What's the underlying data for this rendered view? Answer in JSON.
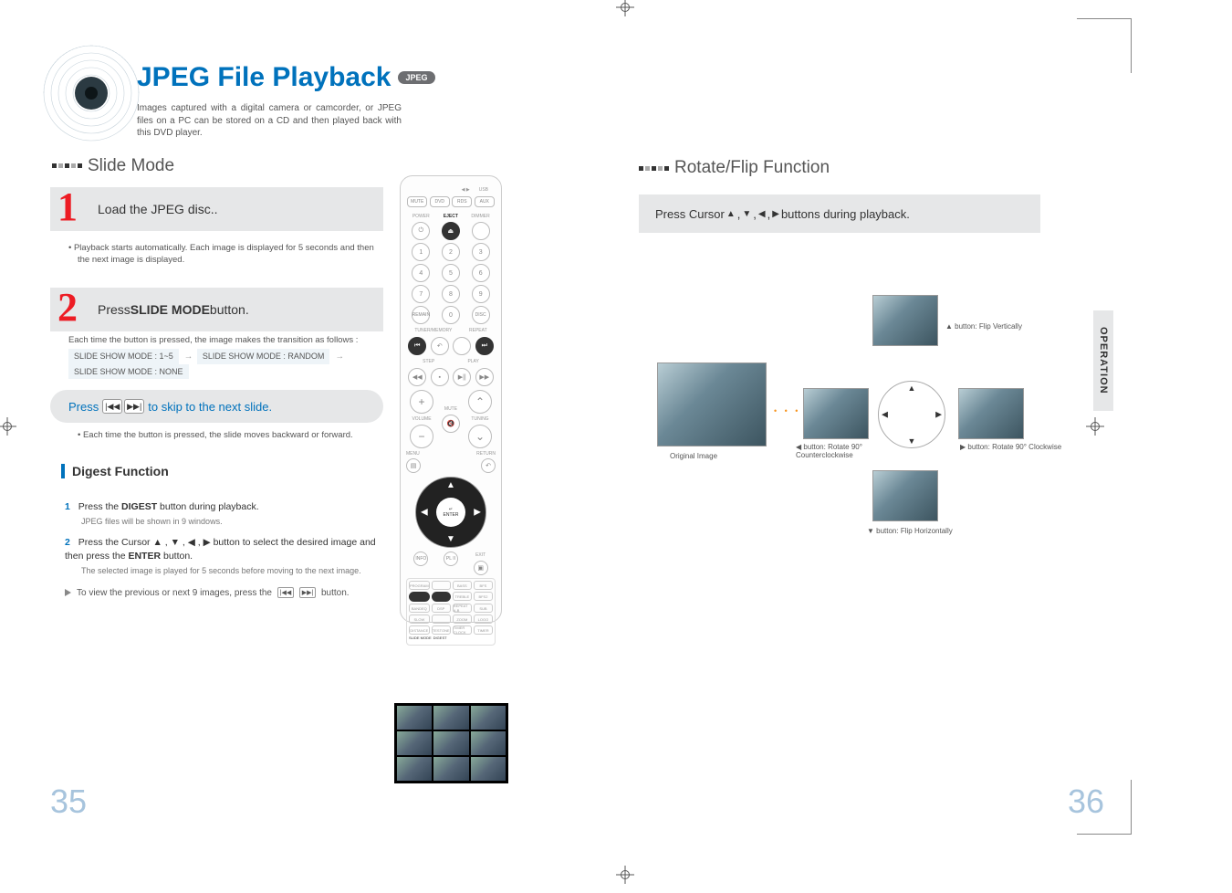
{
  "title": "JPEG File Playback",
  "title_badge": "JPEG",
  "intro": "Images captured with a digital camera or camcorder, or JPEG files on a PC can be stored on a CD and then played back with this DVD player.",
  "side_tab": "OPERATION",
  "page_left": "35",
  "page_right": "36",
  "left": {
    "section": "Slide Mode",
    "step1_num": "1",
    "step1_head": "Load the JPEG disc..",
    "step1_body": "• Playback starts automatically. Each image is displayed for 5 seconds and then the next image is displayed.",
    "step2_num": "2",
    "step2_head_a": "Press ",
    "step2_head_b": "SLIDE MODE",
    "step2_head_c": " button.",
    "transition_intro": "Each time the button is pressed, the image makes the transition as follows :",
    "mode1": "SLIDE SHOW MODE : 1~5",
    "mode2": "SLIDE SHOW MODE : RANDOM",
    "mode3": "SLIDE SHOW MODE : NONE",
    "pill_a": "Press ",
    "pill_b": " to skip to the next slide.",
    "pill_sub": "• Each time the button is pressed, the slide moves backward or forward.",
    "digest_h": "Digest Function",
    "d1_num": "1",
    "d1_a": "Press the ",
    "d1_b": "DIGEST",
    "d1_c": " button during playback.",
    "d1_sub": "JPEG files will be shown in 9 windows.",
    "d2_num": "2",
    "d2_a": "Press the Cursor ",
    "d2_b": " button to select the desired image and then press the ",
    "d2_c": "ENTER",
    "d2_d": " button.",
    "d2_sub": "The selected image is played for 5 seconds before moving to the next image.",
    "note_a": "To view the previous or next 9 images, press the ",
    "note_b": " button."
  },
  "right": {
    "section": "Rotate/Flip Function",
    "band_a": "Press Cursor ",
    "band_b": " buttons during playback.",
    "orig": "Original Image",
    "up": "▲ button: Flip Vertically",
    "left": "◀ button: Rotate 90° Counterclockwise",
    "right_lbl": "▶ button: Rotate 90° Clockwise",
    "down": "▼ button: Flip Horizontally"
  },
  "remote": {
    "top_l1": "MUTE",
    "top_l2": "DVD",
    "top_l3": "RDS",
    "top_l4": "AUX",
    "top_arrow": "◀ ▶",
    "top_usb": "USB",
    "power": "POWER",
    "eject": "EJECT",
    "dimmer": "DIMMER",
    "remain": "REMAIN",
    "zero": "0",
    "disc": "DISC",
    "tunemem": "TUNER/MEMORY",
    "repeat": "REPEAT",
    "step_l": "STEP",
    "play": "PLAY",
    "plus": "+",
    "minus": "−",
    "mute": "MUTE",
    "volume": "VOLUME",
    "tuning": "TUNING",
    "menu": "MENU",
    "return": "RETURN",
    "enter": "ENTER",
    "info": "INFO",
    "pl": "PL II",
    "exit": "EXIT",
    "r1a": "PROGRAM",
    "r1b": "BASS",
    "r1c": "BFS",
    "r2a": "SLIDE MODE",
    "r2b": "DIGEST",
    "r2c": "TREBLE",
    "r2d": "BFS2",
    "r3a": "BANDEQ",
    "r3b": "DSP",
    "r3c": "REPEAT A-B",
    "r3d": "SUB",
    "r4a": "SLOW",
    "r4b": "ZOOM",
    "r4c": "LOGO",
    "r5a": "DISTANCE",
    "r5b": "TESTONE",
    "r5c": "TIMER CLOCK",
    "r5d": "TIMER"
  }
}
